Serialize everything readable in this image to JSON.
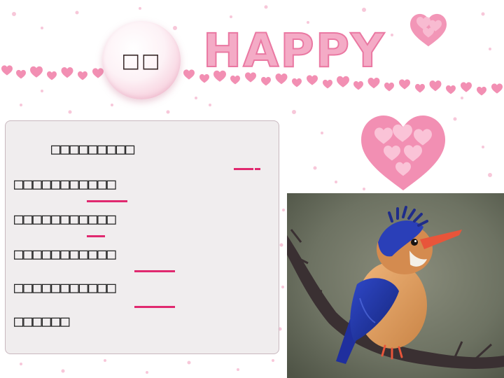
{
  "badge": {
    "label": "□□"
  },
  "decor": {
    "banner_text": "HAPPY"
  },
  "passage": {
    "lines": [
      "    □□□□□□□□□",
      "□□□□□□□□□□□",
      "□□□□□□□□□□□",
      "□□□□□□□□□□□",
      "□□□□□□□□□□□",
      "□□□□□□"
    ]
  },
  "image": {
    "subject": "kingfisher-bird",
    "colors": {
      "background": "#6f7465",
      "wing": "#2a3fb8",
      "breast": "#d99a5b",
      "beak": "#e8553a",
      "branch": "#3a3032"
    }
  },
  "colors": {
    "accent": "#e0296f",
    "heart_pink": "#f07ca6",
    "panel_bg": "#e4dee0"
  }
}
